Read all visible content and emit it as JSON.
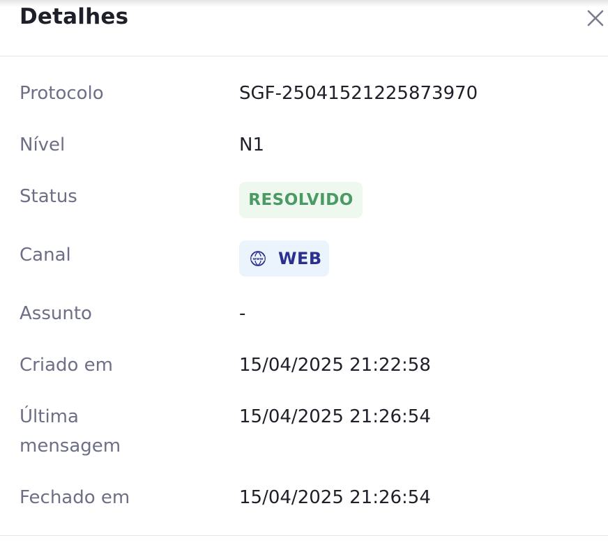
{
  "header": {
    "title": "Detalhes",
    "close_icon": "close-icon"
  },
  "details": {
    "protocolo_label": "Protocolo",
    "protocolo_value": "SGF-25041521225873970",
    "nivel_label": "Nível",
    "nivel_value": "N1",
    "status_label": "Status",
    "status_value": "RESOLVIDO",
    "canal_label": "Canal",
    "canal_value": "WEB",
    "canal_icon": "globe-www-icon",
    "assunto_label": "Assunto",
    "assunto_value": "-",
    "criado_label": "Criado em",
    "criado_value": "15/04/2025 21:22:58",
    "ultima_label_line1": "Última",
    "ultima_label_line2": "mensagem",
    "ultima_value": "15/04/2025 21:26:54",
    "fechado_label": "Fechado em",
    "fechado_value": "15/04/2025 21:26:54"
  },
  "colors": {
    "status_bg": "#eef8ef",
    "status_text": "#4a9a63",
    "channel_bg": "#ebf4fd",
    "channel_text": "#2b2f8f",
    "label_text": "#6d6f86",
    "value_text": "#1f1f2a"
  }
}
